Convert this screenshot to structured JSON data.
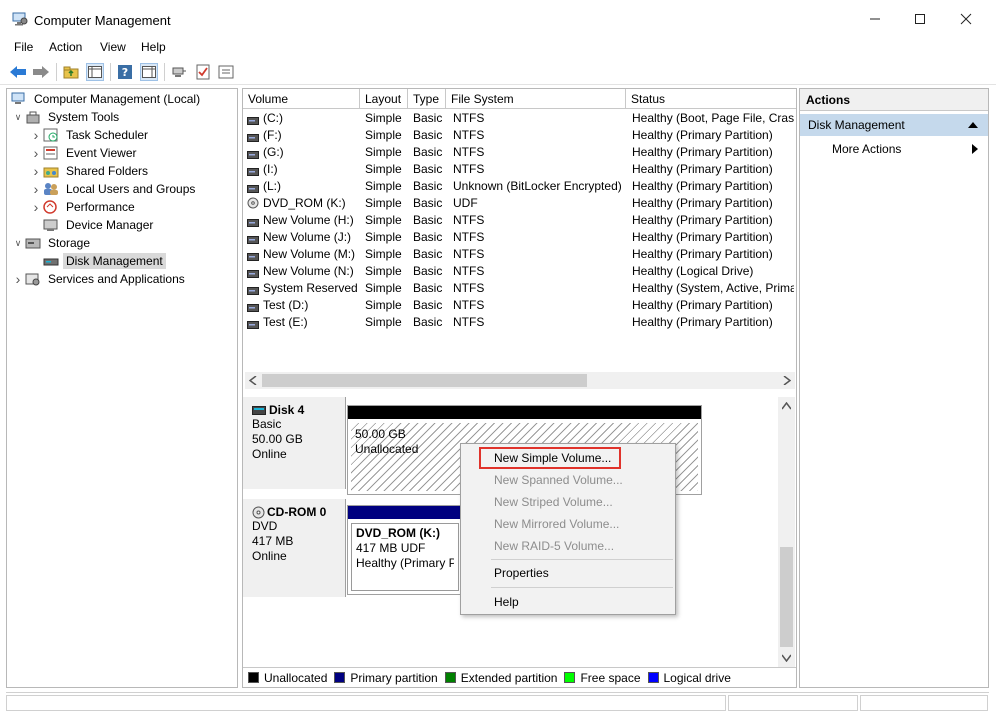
{
  "window": {
    "title": "Computer Management"
  },
  "menu": [
    "File",
    "Action",
    "View",
    "Help"
  ],
  "tree": [
    {
      "label": "Computer Management (Local)",
      "depth": 0,
      "icon": "computer-icon",
      "arrow": ""
    },
    {
      "label": "System Tools",
      "depth": 1,
      "icon": "tools-icon",
      "arrow": "expanded"
    },
    {
      "label": "Task Scheduler",
      "depth": 2,
      "icon": "clock-icon",
      "arrow": "collapsed"
    },
    {
      "label": "Event Viewer",
      "depth": 2,
      "icon": "event-viewer-icon",
      "arrow": "collapsed"
    },
    {
      "label": "Shared Folders",
      "depth": 2,
      "icon": "shared-folder-icon",
      "arrow": "collapsed"
    },
    {
      "label": "Local Users and Groups",
      "depth": 2,
      "icon": "users-icon",
      "arrow": "collapsed"
    },
    {
      "label": "Performance",
      "depth": 2,
      "icon": "performance-icon",
      "arrow": "collapsed"
    },
    {
      "label": "Device Manager",
      "depth": 2,
      "icon": "device-manager-icon",
      "arrow": ""
    },
    {
      "label": "Storage",
      "depth": 1,
      "icon": "storage-icon",
      "arrow": "expanded"
    },
    {
      "label": "Disk Management",
      "depth": 2,
      "icon": "disk-icon",
      "arrow": "",
      "selected": true
    },
    {
      "label": "Services and Applications",
      "depth": 1,
      "icon": "services-icon",
      "arrow": "collapsed"
    }
  ],
  "volumes": {
    "columns": [
      "Volume",
      "Layout",
      "Type",
      "File System",
      "Status"
    ],
    "rows": [
      [
        "(C:)",
        "Simple",
        "Basic",
        "NTFS",
        "Healthy (Boot, Page File, Crash"
      ],
      [
        "(F:)",
        "Simple",
        "Basic",
        "NTFS",
        "Healthy (Primary Partition)"
      ],
      [
        "(G:)",
        "Simple",
        "Basic",
        "NTFS",
        "Healthy (Primary Partition)"
      ],
      [
        "(I:)",
        "Simple",
        "Basic",
        "NTFS",
        "Healthy (Primary Partition)"
      ],
      [
        "(L:)",
        "Simple",
        "Basic",
        "Unknown (BitLocker Encrypted)",
        "Healthy (Primary Partition)"
      ],
      [
        "DVD_ROM (K:)",
        "Simple",
        "Basic",
        "UDF",
        "Healthy (Primary Partition)"
      ],
      [
        "New Volume (H:)",
        "Simple",
        "Basic",
        "NTFS",
        "Healthy (Primary Partition)"
      ],
      [
        "New Volume (J:)",
        "Simple",
        "Basic",
        "NTFS",
        "Healthy (Primary Partition)"
      ],
      [
        "New Volume (M:)",
        "Simple",
        "Basic",
        "NTFS",
        "Healthy (Primary Partition)"
      ],
      [
        "New Volume (N:)",
        "Simple",
        "Basic",
        "NTFS",
        "Healthy (Logical Drive)"
      ],
      [
        "System Reserved",
        "Simple",
        "Basic",
        "NTFS",
        "Healthy (System, Active, Prima"
      ],
      [
        "Test (D:)",
        "Simple",
        "Basic",
        "NTFS",
        "Healthy (Primary Partition)"
      ],
      [
        "Test (E:)",
        "Simple",
        "Basic",
        "NTFS",
        "Healthy (Primary Partition)"
      ]
    ]
  },
  "disks": [
    {
      "name": "Disk 4",
      "lines": [
        "Basic",
        "50.00 GB",
        "Online"
      ],
      "partition": {
        "size": "50.00 GB",
        "state": "Unallocated",
        "bar_color": "#000000"
      }
    },
    {
      "name": "CD-ROM 0",
      "lines": [
        "DVD",
        "417 MB",
        "Online"
      ],
      "partition": {
        "title": "DVD_ROM  (K:)",
        "size": "417 MB UDF",
        "state": "Healthy (Primary Pa",
        "bar_color": "#000080"
      }
    }
  ],
  "legend": [
    {
      "label": "Unallocated",
      "color": "#000000"
    },
    {
      "label": "Primary partition",
      "color": "#000080"
    },
    {
      "label": "Extended partition",
      "color": "#008000"
    },
    {
      "label": "Free space",
      "color": "#00ff00"
    },
    {
      "label": "Logical drive",
      "color": "#0000ff"
    }
  ],
  "actions": {
    "header": "Actions",
    "section": "Disk Management",
    "more": "More Actions"
  },
  "context_menu": [
    {
      "label": "New Simple Volume...",
      "enabled": true,
      "highlighted": true
    },
    {
      "label": "New Spanned Volume...",
      "enabled": false
    },
    {
      "label": "New Striped Volume...",
      "enabled": false
    },
    {
      "label": "New Mirrored Volume...",
      "enabled": false
    },
    {
      "label": "New RAID-5 Volume...",
      "enabled": false
    },
    {
      "label": "Properties",
      "enabled": true
    },
    {
      "label": "Help",
      "enabled": true
    }
  ]
}
